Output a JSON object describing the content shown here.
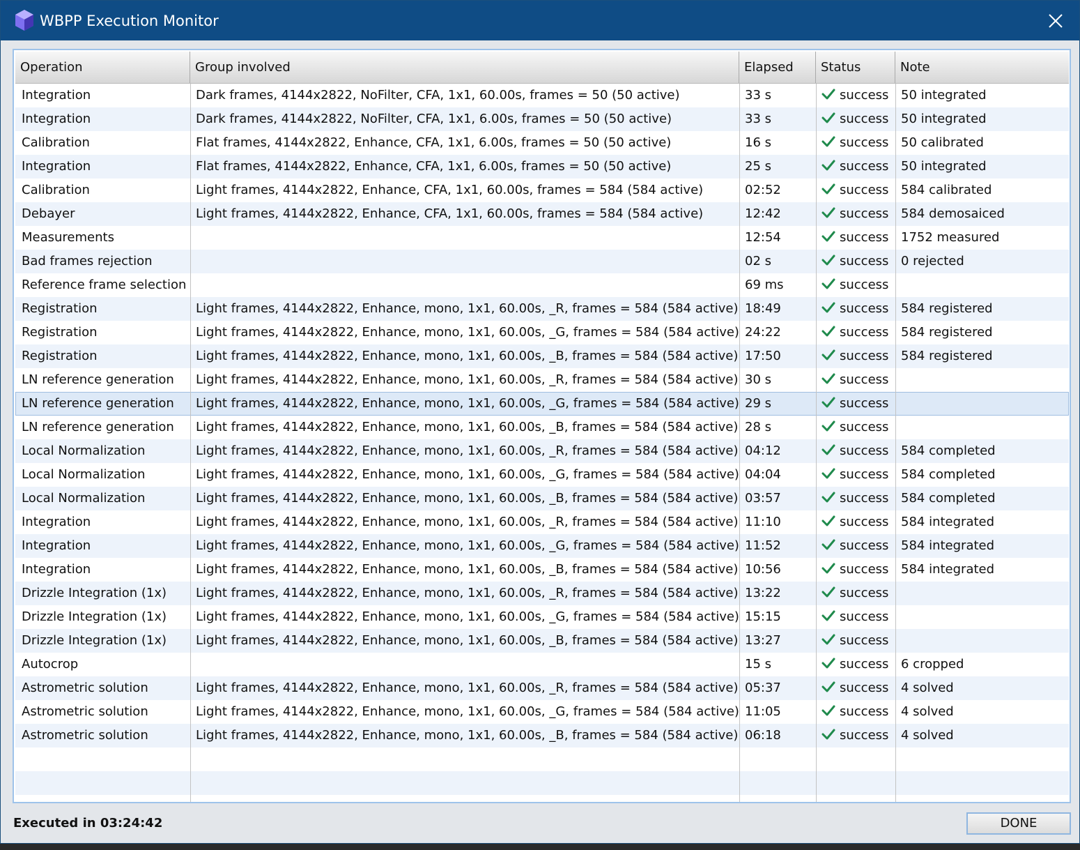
{
  "window": {
    "title": "WBPP Execution Monitor",
    "close_icon": "close-icon",
    "app_icon": "pixinsight-cube-icon"
  },
  "table": {
    "columns": [
      "Operation",
      "Group involved",
      "Elapsed",
      "Status",
      "Note"
    ],
    "selected_row": 13,
    "rows": [
      {
        "operation": "Integration",
        "group": "Dark frames, 4144x2822, NoFilter, CFA, 1x1, 60.00s, frames = 50 (50 active)",
        "elapsed": "33 s",
        "status": "success",
        "note": "50 integrated"
      },
      {
        "operation": "Integration",
        "group": "Dark frames, 4144x2822, NoFilter, CFA, 1x1, 6.00s, frames = 50 (50 active)",
        "elapsed": "33 s",
        "status": "success",
        "note": "50 integrated"
      },
      {
        "operation": "Calibration",
        "group": "Flat frames, 4144x2822, Enhance, CFA, 1x1, 6.00s, frames = 50 (50 active)",
        "elapsed": "16 s",
        "status": "success",
        "note": "50 calibrated"
      },
      {
        "operation": "Integration",
        "group": "Flat frames, 4144x2822, Enhance, CFA, 1x1, 6.00s, frames = 50 (50 active)",
        "elapsed": "25 s",
        "status": "success",
        "note": "50 integrated"
      },
      {
        "operation": "Calibration",
        "group": "Light frames, 4144x2822, Enhance, CFA, 1x1, 60.00s, frames = 584 (584 active)",
        "elapsed": "02:52",
        "status": "success",
        "note": "584 calibrated"
      },
      {
        "operation": "Debayer",
        "group": "Light frames, 4144x2822, Enhance, CFA, 1x1, 60.00s, frames = 584 (584 active)",
        "elapsed": "12:42",
        "status": "success",
        "note": "584 demosaiced"
      },
      {
        "operation": "Measurements",
        "group": "",
        "elapsed": "12:54",
        "status": "success",
        "note": "1752 measured"
      },
      {
        "operation": "Bad frames rejection",
        "group": "",
        "elapsed": "02 s",
        "status": "success",
        "note": "0 rejected"
      },
      {
        "operation": "Reference frame selection",
        "group": "",
        "elapsed": "69 ms",
        "status": "success",
        "note": ""
      },
      {
        "operation": "Registration",
        "group": "Light frames, 4144x2822, Enhance, mono, 1x1, 60.00s, _R, frames = 584 (584 active)",
        "elapsed": "18:49",
        "status": "success",
        "note": "584 registered"
      },
      {
        "operation": "Registration",
        "group": "Light frames, 4144x2822, Enhance, mono, 1x1, 60.00s, _G, frames = 584 (584 active)",
        "elapsed": "24:22",
        "status": "success",
        "note": "584 registered"
      },
      {
        "operation": "Registration",
        "group": "Light frames, 4144x2822, Enhance, mono, 1x1, 60.00s, _B, frames = 584 (584 active)",
        "elapsed": "17:50",
        "status": "success",
        "note": "584 registered"
      },
      {
        "operation": "LN reference generation",
        "group": "Light frames, 4144x2822, Enhance, mono, 1x1, 60.00s, _R, frames = 584 (584 active)",
        "elapsed": "30 s",
        "status": "success",
        "note": ""
      },
      {
        "operation": "LN reference generation",
        "group": "Light frames, 4144x2822, Enhance, mono, 1x1, 60.00s, _G, frames = 584 (584 active)",
        "elapsed": "29 s",
        "status": "success",
        "note": ""
      },
      {
        "operation": "LN reference generation",
        "group": "Light frames, 4144x2822, Enhance, mono, 1x1, 60.00s, _B, frames = 584 (584 active)",
        "elapsed": "28 s",
        "status": "success",
        "note": ""
      },
      {
        "operation": "Local Normalization",
        "group": "Light frames, 4144x2822, Enhance, mono, 1x1, 60.00s, _R, frames = 584 (584 active)",
        "elapsed": "04:12",
        "status": "success",
        "note": "584 completed"
      },
      {
        "operation": "Local Normalization",
        "group": "Light frames, 4144x2822, Enhance, mono, 1x1, 60.00s, _G, frames = 584 (584 active)",
        "elapsed": "04:04",
        "status": "success",
        "note": "584 completed"
      },
      {
        "operation": "Local Normalization",
        "group": "Light frames, 4144x2822, Enhance, mono, 1x1, 60.00s, _B, frames = 584 (584 active)",
        "elapsed": "03:57",
        "status": "success",
        "note": "584 completed"
      },
      {
        "operation": "Integration",
        "group": "Light frames, 4144x2822, Enhance, mono, 1x1, 60.00s, _R, frames = 584 (584 active)",
        "elapsed": "11:10",
        "status": "success",
        "note": "584 integrated"
      },
      {
        "operation": "Integration",
        "group": "Light frames, 4144x2822, Enhance, mono, 1x1, 60.00s, _G, frames = 584 (584 active)",
        "elapsed": "11:52",
        "status": "success",
        "note": "584 integrated"
      },
      {
        "operation": "Integration",
        "group": "Light frames, 4144x2822, Enhance, mono, 1x1, 60.00s, _B, frames = 584 (584 active)",
        "elapsed": "10:56",
        "status": "success",
        "note": "584 integrated"
      },
      {
        "operation": "Drizzle Integration (1x)",
        "group": "Light frames, 4144x2822, Enhance, mono, 1x1, 60.00s, _R, frames = 584 (584 active)",
        "elapsed": "13:22",
        "status": "success",
        "note": ""
      },
      {
        "operation": "Drizzle Integration (1x)",
        "group": "Light frames, 4144x2822, Enhance, mono, 1x1, 60.00s, _G, frames = 584 (584 active)",
        "elapsed": "15:15",
        "status": "success",
        "note": ""
      },
      {
        "operation": "Drizzle Integration (1x)",
        "group": "Light frames, 4144x2822, Enhance, mono, 1x1, 60.00s, _B, frames = 584 (584 active)",
        "elapsed": "13:27",
        "status": "success",
        "note": ""
      },
      {
        "operation": "Autocrop",
        "group": "",
        "elapsed": "15 s",
        "status": "success",
        "note": "6 cropped"
      },
      {
        "operation": "Astrometric solution",
        "group": "Light frames, 4144x2822, Enhance, mono, 1x1, 60.00s, _R, frames = 584 (584 active)",
        "elapsed": "05:37",
        "status": "success",
        "note": "4 solved"
      },
      {
        "operation": "Astrometric solution",
        "group": "Light frames, 4144x2822, Enhance, mono, 1x1, 60.00s, _G, frames = 584 (584 active)",
        "elapsed": "11:05",
        "status": "success",
        "note": "4 solved"
      },
      {
        "operation": "Astrometric solution",
        "group": "Light frames, 4144x2822, Enhance, mono, 1x1, 60.00s, _B, frames = 584 (584 active)",
        "elapsed": "06:18",
        "status": "success",
        "note": "4 solved"
      }
    ],
    "status_icon": "check-icon",
    "check_color": "#1f8a4c"
  },
  "footer": {
    "executed_text": "Executed in 03:24:42",
    "done_label": "DONE"
  },
  "colors": {
    "titlebar": "#0f4c85",
    "row_alt": "#edf3fb",
    "row_selected": "#dde9f7",
    "frame_border": "#9ec3ea"
  }
}
